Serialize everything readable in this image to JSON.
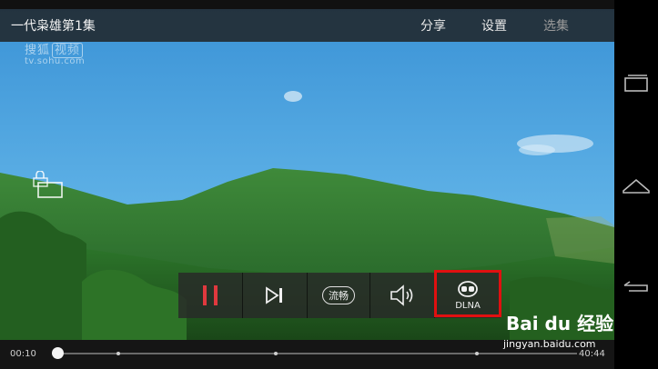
{
  "video": {
    "title": "一代枭雄第1集"
  },
  "top_menu": {
    "share": "分享",
    "settings": "设置",
    "episodes": "选集"
  },
  "watermark": {
    "brand_cn": "搜狐",
    "brand_box": "视频",
    "domain": "tv.sohu.com"
  },
  "controls": {
    "quality": "流畅",
    "dlna": "DLNA"
  },
  "progress": {
    "current_time": "00:10",
    "total_time": "40:44",
    "played_fraction": 0.004
  },
  "overlay_watermark": {
    "brand": "Bai du 经验",
    "url": "jingyan.baidu.com"
  },
  "colors": {
    "highlight": "#e01010",
    "pause_accent": "#e0393e"
  },
  "icons": [
    "lock-icon",
    "pause-icon",
    "next-icon",
    "volume-icon",
    "dlna-icon",
    "recents-icon",
    "home-icon",
    "back-icon"
  ]
}
